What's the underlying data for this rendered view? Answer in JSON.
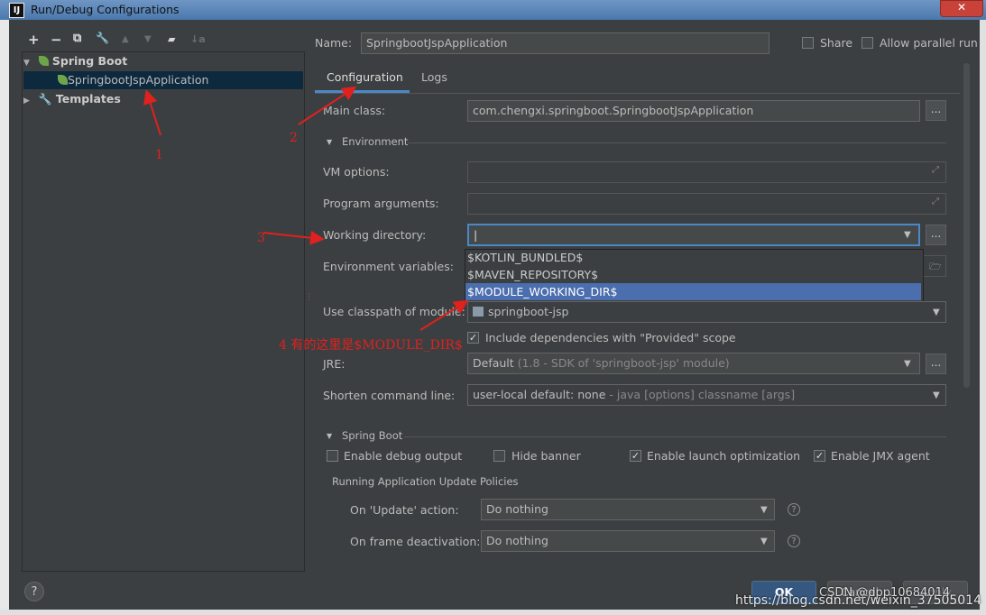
{
  "window": {
    "title": "Run/Debug Configurations",
    "close_label": "✕"
  },
  "toolbar": {
    "add": "+",
    "remove": "−",
    "copy": "⧉",
    "edit": "🔧",
    "up": "▲",
    "down": "▼",
    "folder": "▰",
    "sort": "↓a"
  },
  "tree": {
    "group_label": "Spring Boot",
    "item_label": "SpringbootJspApplication",
    "templates_label": "Templates"
  },
  "form": {
    "name_label": "Name:",
    "name_value": "SpringbootJspApplication",
    "share_label": "Share",
    "parallel_label": "Allow parallel run",
    "tabs": [
      "Configuration",
      "Logs"
    ],
    "main_class_label": "Main class:",
    "main_class_value": "com.chengxi.springboot.SpringbootJspApplication",
    "environment_section": "Environment",
    "vm_options_label": "VM options:",
    "program_args_label": "Program arguments:",
    "working_dir_label": "Working directory:",
    "env_vars_label": "Environment variables:",
    "classpath_label": "Use classpath of module:",
    "classpath_value": "springboot-jsp",
    "include_deps_label": "Include dependencies with \"Provided\" scope",
    "jre_label": "JRE:",
    "jre_value_main": "Default",
    "jre_value_detail": "(1.8 - SDK of 'springboot-jsp' module)",
    "shorten_label": "Shorten command line:",
    "shorten_value_main": "user-local default: none",
    "shorten_value_detail": "- java [options] classname [args]",
    "spring_boot_section": "Spring Boot",
    "debug_output_label": "Enable debug output",
    "hide_banner_label": "Hide banner",
    "launch_opt_label": "Enable launch optimization",
    "jmx_label": "Enable JMX agent",
    "policies_label": "Running Application Update Policies",
    "update_action_label": "On 'Update' action:",
    "update_action_value": "Do nothing",
    "frame_deactivation_label": "On frame deactivation:",
    "frame_deactivation_value": "Do nothing",
    "dots": "..."
  },
  "dropdown_options": [
    "$KOTLIN_BUNDLED$",
    "$MAVEN_REPOSITORY$",
    "$MODULE_WORKING_DIR$"
  ],
  "buttons": {
    "ok": "OK",
    "cancel": "Cancel",
    "apply": "Apply",
    "help": "?"
  },
  "annotations": {
    "a1": "1",
    "a2": "2",
    "a3": "3",
    "a4": "4 有的这里是$MODULE_DIR$"
  },
  "watermark": "https://blog.csdn.net/weixin_37505014",
  "watermark2": "CSDN @dpp10684014",
  "colors": {
    "background": "#3c3f41",
    "selection": "#4b6eaf",
    "tab_accent": "#4a88c7",
    "annotation": "#e0211d"
  }
}
